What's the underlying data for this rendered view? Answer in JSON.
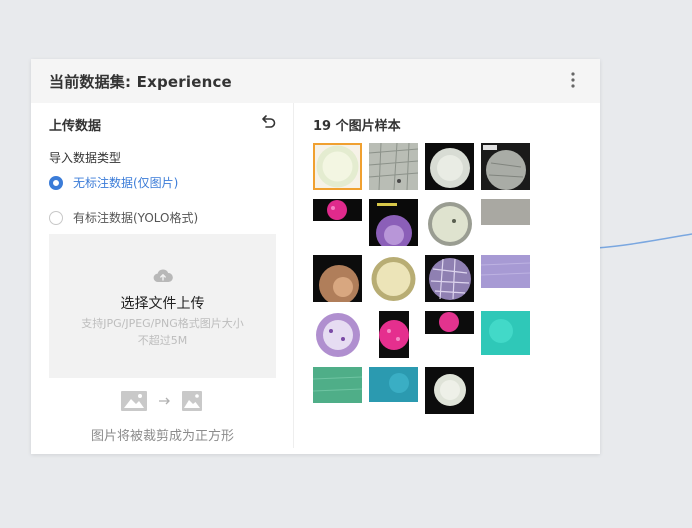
{
  "card": {
    "title": "当前数据集: Experience"
  },
  "upload": {
    "title": "上传数据",
    "import_type_label": "导入数据类型",
    "options": [
      {
        "label": "无标注数据(仅图片)",
        "selected": true
      },
      {
        "label": "有标注数据(YOLO格式)",
        "selected": false
      }
    ],
    "dropzone": {
      "title": "选择文件上传",
      "hint_line1": "支持JPG/JPEG/PNG格式图片大小",
      "hint_line2": "不超过5M"
    },
    "crop_note": "图片将被裁剪成为正方形"
  },
  "samples": {
    "title": "19 个图片样本",
    "items": [
      {
        "kind": "bright-scope",
        "selected": true
      },
      {
        "kind": "onion-cells",
        "selected": false
      },
      {
        "kind": "dark-scope",
        "selected": false
      },
      {
        "kind": "gray-scope",
        "selected": false
      },
      {
        "kind": "pink-strip",
        "selected": false
      },
      {
        "kind": "purple-scope",
        "selected": false
      },
      {
        "kind": "light-scope",
        "selected": false
      },
      {
        "kind": "gray-flat",
        "selected": false
      },
      {
        "kind": "brown-scope",
        "selected": false
      },
      {
        "kind": "yellow-scope",
        "selected": false
      },
      {
        "kind": "cells-scope",
        "selected": false
      },
      {
        "kind": "lavender-flat",
        "selected": false
      },
      {
        "kind": "purple-dots-scope",
        "selected": false
      },
      {
        "kind": "pink-tall",
        "selected": false
      },
      {
        "kind": "pink-strip",
        "selected": false
      },
      {
        "kind": "teal-flat",
        "selected": false
      },
      {
        "kind": "green-scope",
        "selected": false
      },
      {
        "kind": "teal-plain",
        "selected": false
      },
      {
        "kind": "small-dark-scope",
        "selected": false
      }
    ]
  },
  "colors": {
    "accent": "#3b7cd8",
    "selected_border": "#f0a030"
  }
}
